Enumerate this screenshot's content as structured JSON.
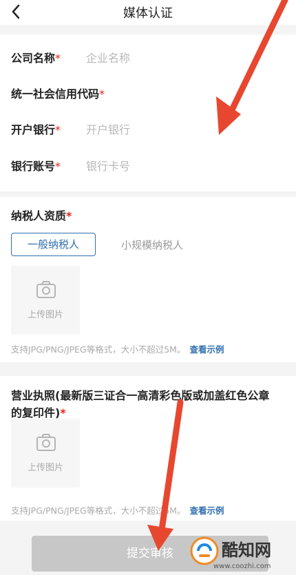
{
  "header": {
    "title": "媒体认证",
    "back_icon": "chevron-left-icon"
  },
  "form": {
    "company_name": {
      "label": "公司名称",
      "required": "*",
      "placeholder": "企业名称"
    },
    "credit_code": {
      "label": "统一社会信用代码",
      "required": "*"
    },
    "bank": {
      "label": "开户银行",
      "required": "*",
      "placeholder": "开户银行"
    },
    "account": {
      "label": "银行账号",
      "required": "*",
      "placeholder": "银行卡号"
    }
  },
  "taxpayer": {
    "label": "纳税人资质",
    "required": "*",
    "options": [
      "一般纳税人",
      "小规模纳税人"
    ],
    "selected": "一般纳税人",
    "upload_label": "上传图片",
    "hint": "支持JPG/PNG/JPEG等格式，大小不超过5M。",
    "hint_link": "查看示例"
  },
  "license": {
    "label_line1": "营业执照(最新版三证合一高清彩色版或加盖红色公章",
    "label_line2": "的复印件)",
    "required": "*",
    "upload_label": "上传图片",
    "hint": "支持JPG/PNG/JPEG等格式，大小不超过5M。",
    "hint_link": "查看示例"
  },
  "submit": {
    "label": "提交审核"
  },
  "watermark": {
    "name": "酷知网",
    "url": "www.coozhi.com"
  },
  "colors": {
    "accent": "#2f6fb0",
    "required": "#e2231a",
    "arrow": "#e8472f",
    "button_disabled": "#c7c7c7"
  }
}
